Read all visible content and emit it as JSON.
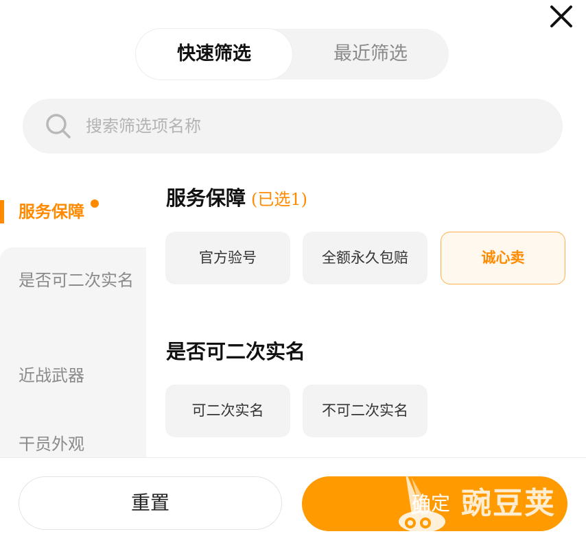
{
  "tabs": {
    "active": "快速筛选",
    "inactive": "最近筛选"
  },
  "search": {
    "placeholder": "搜索筛选项名称"
  },
  "sidebar": {
    "items": [
      {
        "label": "服务保障"
      },
      {
        "label": "是否可二次实名"
      },
      {
        "label": "近战武器"
      },
      {
        "label": "干员外观"
      }
    ]
  },
  "sections": [
    {
      "title": "服务保障",
      "count": "(已选1)",
      "options": [
        "官方验号",
        "全额永久包赔",
        "诚心卖"
      ]
    },
    {
      "title": "是否可二次实名",
      "options": [
        "可二次实名",
        "不可二次实名"
      ]
    }
  ],
  "footer": {
    "reset": "重置",
    "confirm": "确定"
  },
  "watermark": {
    "text": "豌豆荚"
  },
  "colors": {
    "accent": "#ff8a00",
    "confirm_bg": "#ff9a00",
    "chip_bg": "#f3f3f3"
  },
  "icons": {
    "close": "close-icon",
    "search": "search-icon"
  }
}
